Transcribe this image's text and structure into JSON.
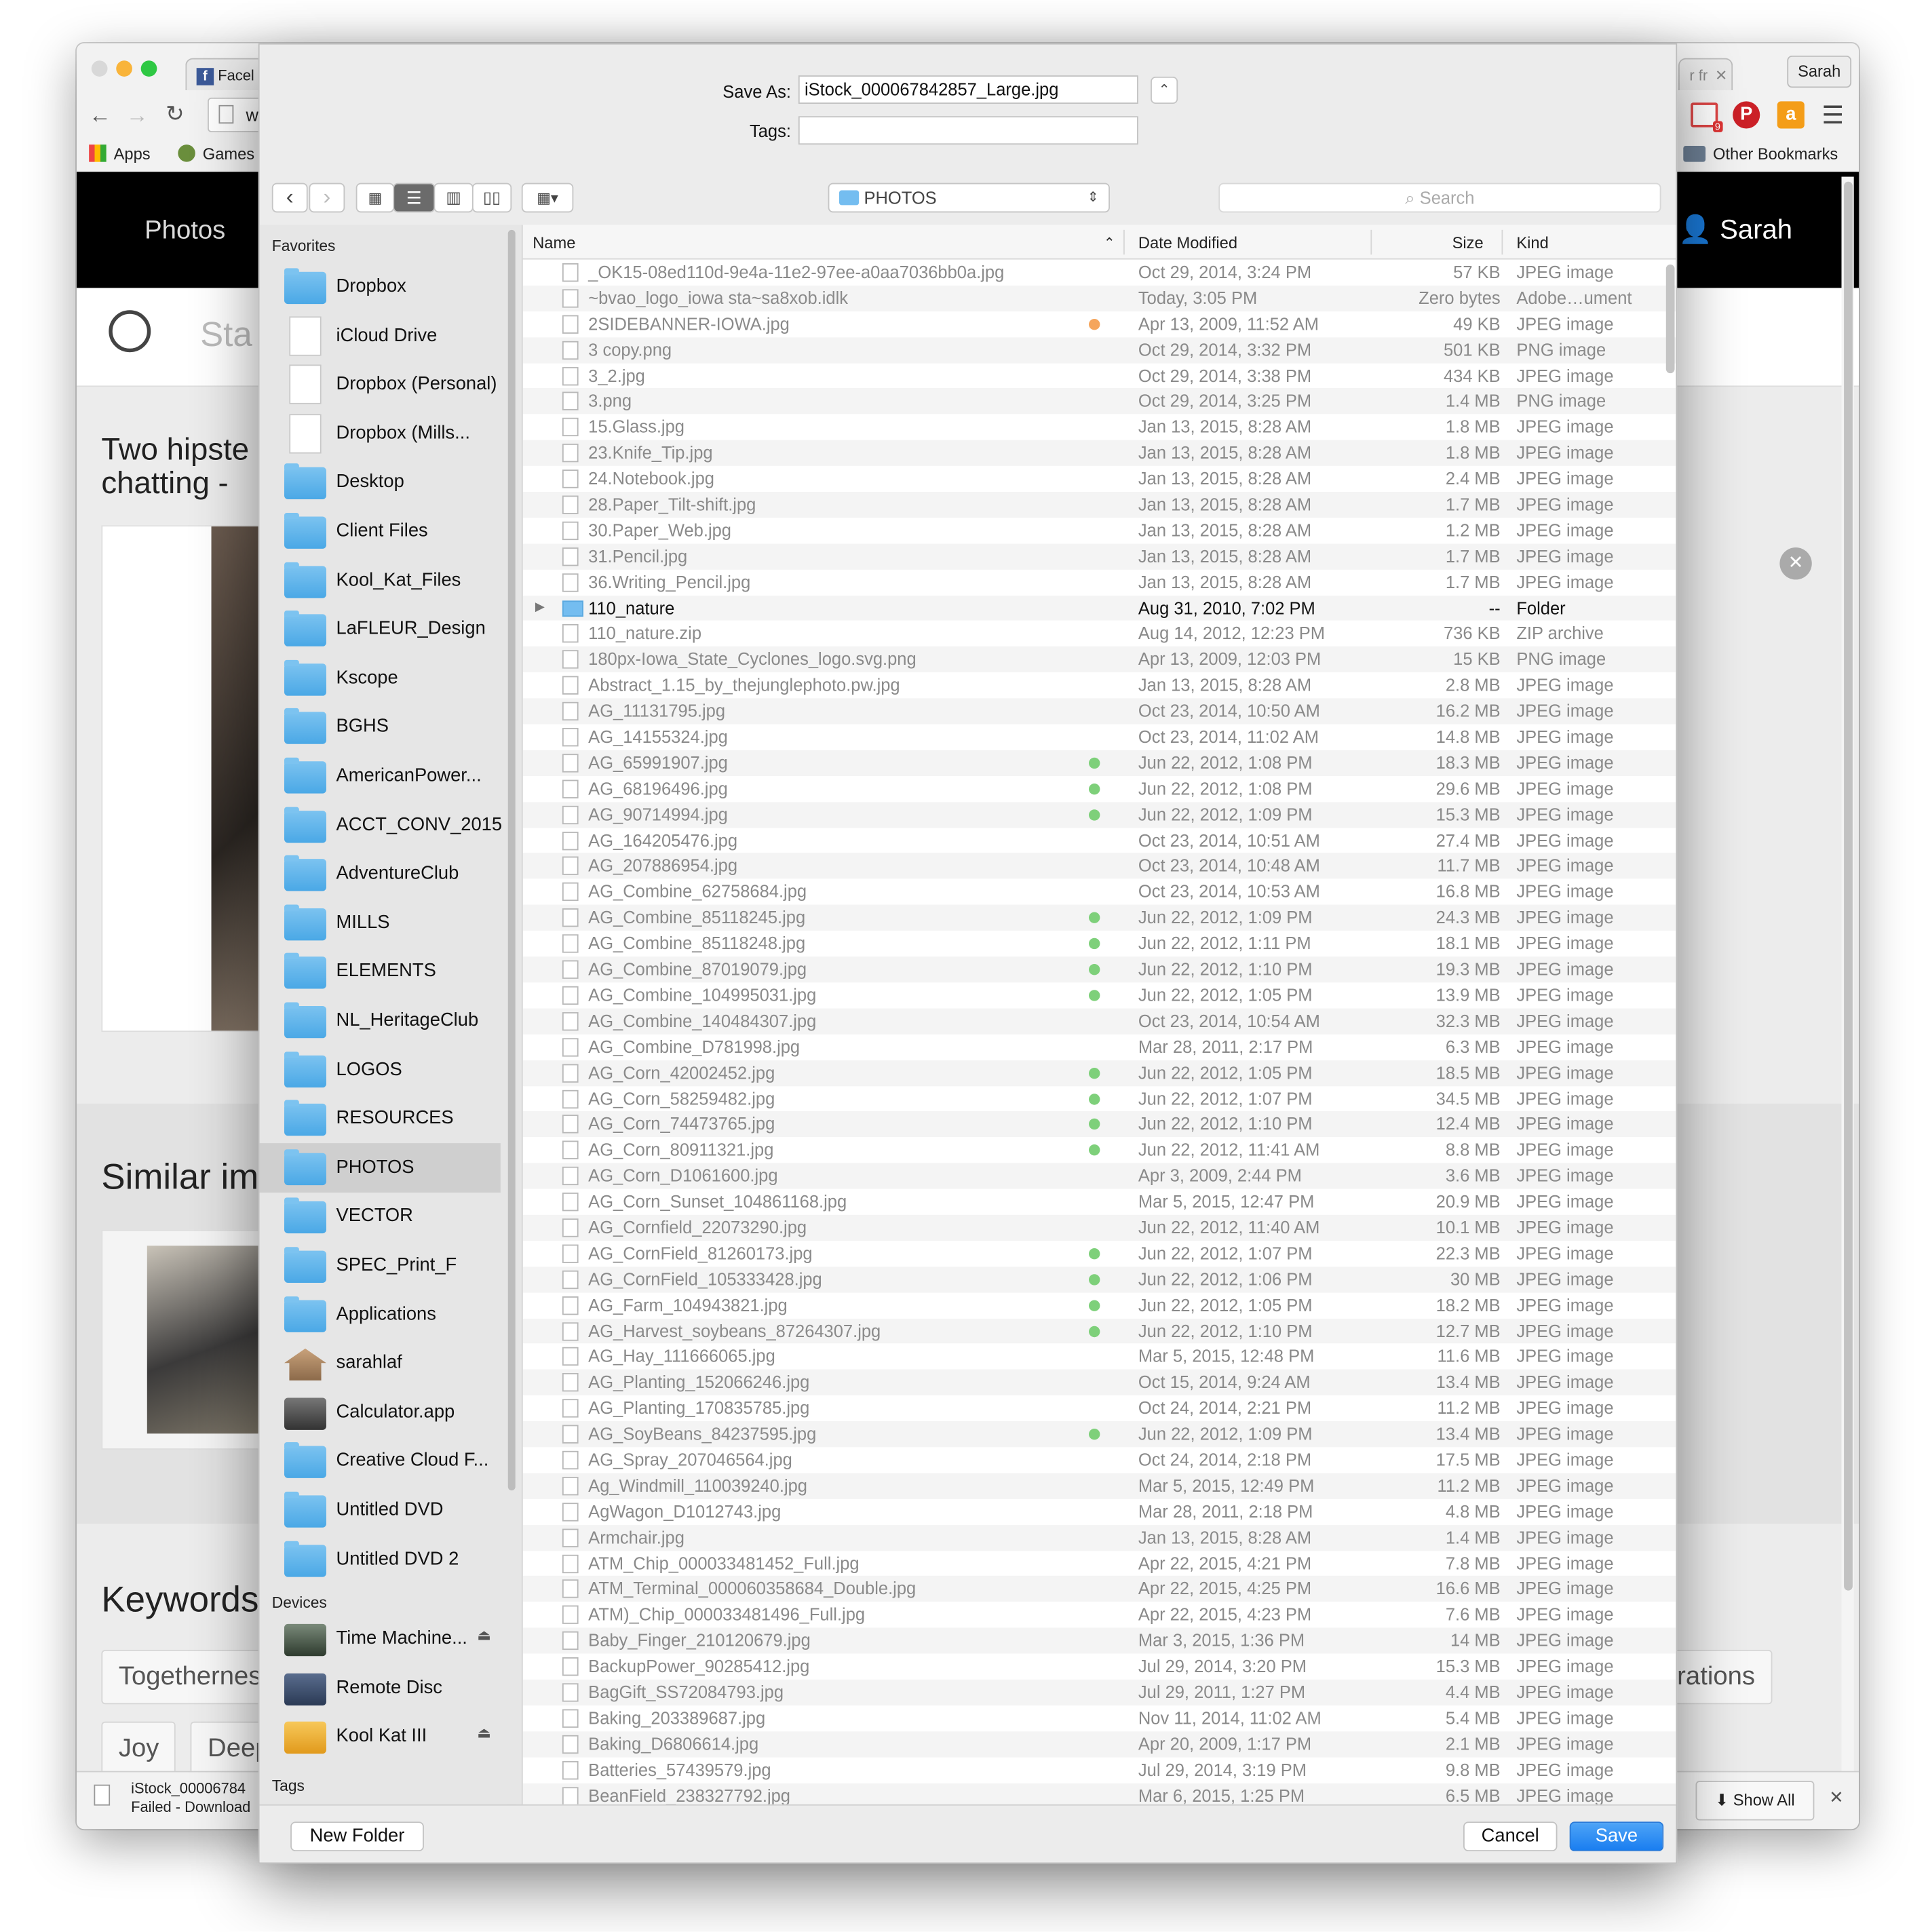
{
  "browser": {
    "tabs": [
      {
        "label": "Facel"
      },
      {
        "label": "r fr"
      }
    ],
    "profile": "Sarah",
    "address": "ww",
    "bookmarks": {
      "apps": "Apps",
      "games": "Games",
      "other": "Other Bookmarks"
    },
    "icon_badge": "9",
    "site": {
      "nav_photos": "Photos",
      "user": "Sarah",
      "search_placeholder": "Sta",
      "title_line1": "Two hipste",
      "title_line2": "chatting -",
      "similar": "Similar im",
      "keywords": "Keywords",
      "kw1": "Togethernes",
      "kw2": "rations",
      "kw3": "Joy",
      "kw4": "Deep"
    },
    "download": {
      "filename": "iStock_00006784",
      "status": "Failed - Download",
      "show_all": "Show All"
    }
  },
  "dialog": {
    "save_as_label": "Save As:",
    "save_as_value": "iStock_000067842857_Large.jpg",
    "tags_label": "Tags:",
    "tags_value": "",
    "location": "PHOTOS",
    "search_placeholder": "Search",
    "favorites_header": "Favorites",
    "devices_header": "Devices",
    "tags_header": "Tags",
    "favorites": [
      {
        "label": "Dropbox",
        "icon": "dropbox-folder-icon"
      },
      {
        "label": "iCloud Drive",
        "icon": "document-icon"
      },
      {
        "label": "Dropbox (Personal)",
        "icon": "document-icon"
      },
      {
        "label": "Dropbox (Mills...",
        "icon": "document-icon"
      },
      {
        "label": "Desktop",
        "icon": "desktop-folder-icon"
      },
      {
        "label": "Client Files",
        "icon": "folder-icon"
      },
      {
        "label": "Kool_Kat_Files",
        "icon": "folder-icon"
      },
      {
        "label": "LaFLEUR_Design",
        "icon": "folder-icon"
      },
      {
        "label": "Kscope",
        "icon": "folder-icon"
      },
      {
        "label": "BGHS",
        "icon": "folder-icon"
      },
      {
        "label": "AmericanPower...",
        "icon": "folder-icon"
      },
      {
        "label": "ACCT_CONV_2015",
        "icon": "folder-icon"
      },
      {
        "label": "AdventureClub",
        "icon": "folder-icon"
      },
      {
        "label": "MILLS",
        "icon": "folder-icon"
      },
      {
        "label": "ELEMENTS",
        "icon": "folder-icon"
      },
      {
        "label": "NL_HeritageClub",
        "icon": "folder-icon"
      },
      {
        "label": "LOGOS",
        "icon": "folder-icon"
      },
      {
        "label": "RESOURCES",
        "icon": "folder-icon"
      },
      {
        "label": "PHOTOS",
        "icon": "folder-icon"
      },
      {
        "label": "VECTOR",
        "icon": "folder-icon"
      },
      {
        "label": "SPEC_Print_F",
        "icon": "folder-icon"
      },
      {
        "label": "Applications",
        "icon": "applications-folder-icon"
      },
      {
        "label": "sarahlaf",
        "icon": "home-icon"
      },
      {
        "label": "Calculator.app",
        "icon": "calculator-icon"
      },
      {
        "label": "Creative Cloud F...",
        "icon": "creative-cloud-folder-icon"
      },
      {
        "label": "Untitled DVD",
        "icon": "dvd-icon"
      },
      {
        "label": "Untitled DVD 2",
        "icon": "dvd-icon"
      }
    ],
    "devices": [
      {
        "label": "Time Machine...",
        "icon": "time-machine-icon"
      },
      {
        "label": "Remote Disc",
        "icon": "remote-disc-icon"
      },
      {
        "label": "Kool Kat III",
        "icon": "external-drive-icon"
      }
    ],
    "columns": {
      "name": "Name",
      "date": "Date Modified",
      "size": "Size",
      "kind": "Kind"
    },
    "files": [
      {
        "name": "_OK15-08ed110d-9e4a-11e2-97ee-a0aa7036bb0a.jpg",
        "date": "Oct 29, 2014, 3:24 PM",
        "size": "57 KB",
        "kind": "JPEG image"
      },
      {
        "name": "~bvao_logo_iowa sta~sa8xob.idlk",
        "date": "Today, 3:05 PM",
        "size": "Zero bytes",
        "kind": "Adobe…ument"
      },
      {
        "name": "2SIDEBANNER-IOWA.jpg",
        "date": "Apr 13, 2009, 11:52 AM",
        "size": "49 KB",
        "kind": "JPEG image",
        "tag": "#f5a55c"
      },
      {
        "name": "3 copy.png",
        "date": "Oct 29, 2014, 3:32 PM",
        "size": "501 KB",
        "kind": "PNG image"
      },
      {
        "name": "3_2.jpg",
        "date": "Oct 29, 2014, 3:38 PM",
        "size": "434 KB",
        "kind": "JPEG image"
      },
      {
        "name": "3.png",
        "date": "Oct 29, 2014, 3:25 PM",
        "size": "1.4 MB",
        "kind": "PNG image"
      },
      {
        "name": "15.Glass.jpg",
        "date": "Jan 13, 2015, 8:28 AM",
        "size": "1.8 MB",
        "kind": "JPEG image"
      },
      {
        "name": "23.Knife_Tip.jpg",
        "date": "Jan 13, 2015, 8:28 AM",
        "size": "1.8 MB",
        "kind": "JPEG image"
      },
      {
        "name": "24.Notebook.jpg",
        "date": "Jan 13, 2015, 8:28 AM",
        "size": "2.4 MB",
        "kind": "JPEG image"
      },
      {
        "name": "28.Paper_Tilt-shift.jpg",
        "date": "Jan 13, 2015, 8:28 AM",
        "size": "1.7 MB",
        "kind": "JPEG image"
      },
      {
        "name": "30.Paper_Web.jpg",
        "date": "Jan 13, 2015, 8:28 AM",
        "size": "1.2 MB",
        "kind": "JPEG image"
      },
      {
        "name": "31.Pencil.jpg",
        "date": "Jan 13, 2015, 8:28 AM",
        "size": "1.7 MB",
        "kind": "JPEG image"
      },
      {
        "name": "36.Writing_Pencil.jpg",
        "date": "Jan 13, 2015, 8:28 AM",
        "size": "1.7 MB",
        "kind": "JPEG image"
      },
      {
        "name": "110_nature",
        "date": "Aug 31, 2010, 7:02 PM",
        "size": "--",
        "kind": "Folder",
        "folder": true
      },
      {
        "name": "110_nature.zip",
        "date": "Aug 14, 2012, 12:23 PM",
        "size": "736 KB",
        "kind": "ZIP archive"
      },
      {
        "name": "180px-Iowa_State_Cyclones_logo.svg.png",
        "date": "Apr 13, 2009, 12:03 PM",
        "size": "15 KB",
        "kind": "PNG image"
      },
      {
        "name": "Abstract_1.15_by_thejunglephoto.pw.jpg",
        "date": "Jan 13, 2015, 8:28 AM",
        "size": "2.8 MB",
        "kind": "JPEG image"
      },
      {
        "name": "AG_11131795.jpg",
        "date": "Oct 23, 2014, 10:50 AM",
        "size": "16.2 MB",
        "kind": "JPEG image"
      },
      {
        "name": "AG_14155324.jpg",
        "date": "Oct 23, 2014, 11:02 AM",
        "size": "14.8 MB",
        "kind": "JPEG image"
      },
      {
        "name": "AG_65991907.jpg",
        "date": "Jun 22, 2012, 1:08 PM",
        "size": "18.3 MB",
        "kind": "JPEG image",
        "tag": "#7ed07a"
      },
      {
        "name": "AG_68196496.jpg",
        "date": "Jun 22, 2012, 1:08 PM",
        "size": "29.6 MB",
        "kind": "JPEG image",
        "tag": "#7ed07a"
      },
      {
        "name": "AG_90714994.jpg",
        "date": "Jun 22, 2012, 1:09 PM",
        "size": "15.3 MB",
        "kind": "JPEG image",
        "tag": "#7ed07a"
      },
      {
        "name": "AG_164205476.jpg",
        "date": "Oct 23, 2014, 10:51 AM",
        "size": "27.4 MB",
        "kind": "JPEG image"
      },
      {
        "name": "AG_207886954.jpg",
        "date": "Oct 23, 2014, 10:48 AM",
        "size": "11.7 MB",
        "kind": "JPEG image"
      },
      {
        "name": "AG_Combine_62758684.jpg",
        "date": "Oct 23, 2014, 10:53 AM",
        "size": "16.8 MB",
        "kind": "JPEG image"
      },
      {
        "name": "AG_Combine_85118245.jpg",
        "date": "Jun 22, 2012, 1:09 PM",
        "size": "24.3 MB",
        "kind": "JPEG image",
        "tag": "#7ed07a"
      },
      {
        "name": "AG_Combine_85118248.jpg",
        "date": "Jun 22, 2012, 1:11 PM",
        "size": "18.1 MB",
        "kind": "JPEG image",
        "tag": "#7ed07a"
      },
      {
        "name": "AG_Combine_87019079.jpg",
        "date": "Jun 22, 2012, 1:10 PM",
        "size": "19.3 MB",
        "kind": "JPEG image",
        "tag": "#7ed07a"
      },
      {
        "name": "AG_Combine_104995031.jpg",
        "date": "Jun 22, 2012, 1:05 PM",
        "size": "13.9 MB",
        "kind": "JPEG image",
        "tag": "#7ed07a"
      },
      {
        "name": "AG_Combine_140484307.jpg",
        "date": "Oct 23, 2014, 10:54 AM",
        "size": "32.3 MB",
        "kind": "JPEG image"
      },
      {
        "name": "AG_Combine_D781998.jpg",
        "date": "Mar 28, 2011, 2:17 PM",
        "size": "6.3 MB",
        "kind": "JPEG image"
      },
      {
        "name": "AG_Corn_42002452.jpg",
        "date": "Jun 22, 2012, 1:05 PM",
        "size": "18.5 MB",
        "kind": "JPEG image",
        "tag": "#7ed07a"
      },
      {
        "name": "AG_Corn_58259482.jpg",
        "date": "Jun 22, 2012, 1:07 PM",
        "size": "34.5 MB",
        "kind": "JPEG image",
        "tag": "#7ed07a"
      },
      {
        "name": "AG_Corn_74473765.jpg",
        "date": "Jun 22, 2012, 1:10 PM",
        "size": "12.4 MB",
        "kind": "JPEG image",
        "tag": "#7ed07a"
      },
      {
        "name": "AG_Corn_80911321.jpg",
        "date": "Jun 22, 2012, 11:41 AM",
        "size": "8.8 MB",
        "kind": "JPEG image",
        "tag": "#7ed07a"
      },
      {
        "name": "AG_Corn_D1061600.jpg",
        "date": "Apr 3, 2009, 2:44 PM",
        "size": "3.6 MB",
        "kind": "JPEG image"
      },
      {
        "name": "AG_Corn_Sunset_104861168.jpg",
        "date": "Mar 5, 2015, 12:47 PM",
        "size": "20.9 MB",
        "kind": "JPEG image"
      },
      {
        "name": "AG_Cornfield_22073290.jpg",
        "date": "Jun 22, 2012, 11:40 AM",
        "size": "10.1 MB",
        "kind": "JPEG image"
      },
      {
        "name": "AG_CornField_81260173.jpg",
        "date": "Jun 22, 2012, 1:07 PM",
        "size": "22.3 MB",
        "kind": "JPEG image",
        "tag": "#7ed07a"
      },
      {
        "name": "AG_CornField_105333428.jpg",
        "date": "Jun 22, 2012, 1:06 PM",
        "size": "30 MB",
        "kind": "JPEG image",
        "tag": "#7ed07a"
      },
      {
        "name": "AG_Farm_104943821.jpg",
        "date": "Jun 22, 2012, 1:05 PM",
        "size": "18.2 MB",
        "kind": "JPEG image",
        "tag": "#7ed07a"
      },
      {
        "name": "AG_Harvest_soybeans_87264307.jpg",
        "date": "Jun 22, 2012, 1:10 PM",
        "size": "12.7 MB",
        "kind": "JPEG image",
        "tag": "#7ed07a"
      },
      {
        "name": "AG_Hay_111666065.jpg",
        "date": "Mar 5, 2015, 12:48 PM",
        "size": "11.6 MB",
        "kind": "JPEG image"
      },
      {
        "name": "AG_Planting_152066246.jpg",
        "date": "Oct 15, 2014, 9:24 AM",
        "size": "13.4 MB",
        "kind": "JPEG image"
      },
      {
        "name": "AG_Planting_170835785.jpg",
        "date": "Oct 24, 2014, 2:21 PM",
        "size": "11.2 MB",
        "kind": "JPEG image"
      },
      {
        "name": "AG_SoyBeans_84237595.jpg",
        "date": "Jun 22, 2012, 1:09 PM",
        "size": "13.4 MB",
        "kind": "JPEG image",
        "tag": "#7ed07a"
      },
      {
        "name": "AG_Spray_207046564.jpg",
        "date": "Oct 24, 2014, 2:18 PM",
        "size": "17.5 MB",
        "kind": "JPEG image"
      },
      {
        "name": "Ag_Windmill_110039240.jpg",
        "date": "Mar 5, 2015, 12:49 PM",
        "size": "11.2 MB",
        "kind": "JPEG image"
      },
      {
        "name": "AgWagon_D1012743.jpg",
        "date": "Mar 28, 2011, 2:18 PM",
        "size": "4.8 MB",
        "kind": "JPEG image"
      },
      {
        "name": "Armchair.jpg",
        "date": "Jan 13, 2015, 8:28 AM",
        "size": "1.4 MB",
        "kind": "JPEG image"
      },
      {
        "name": "ATM_Chip_000033481452_Full.jpg",
        "date": "Apr 22, 2015, 4:21 PM",
        "size": "7.8 MB",
        "kind": "JPEG image"
      },
      {
        "name": "ATM_Terminal_000060358684_Double.jpg",
        "date": "Apr 22, 2015, 4:25 PM",
        "size": "16.6 MB",
        "kind": "JPEG image"
      },
      {
        "name": "ATM)_Chip_000033481496_Full.jpg",
        "date": "Apr 22, 2015, 4:23 PM",
        "size": "7.6 MB",
        "kind": "JPEG image"
      },
      {
        "name": "Baby_Finger_210120679.jpg",
        "date": "Mar 3, 2015, 1:36 PM",
        "size": "14 MB",
        "kind": "JPEG image"
      },
      {
        "name": "BackupPower_90285412.jpg",
        "date": "Jul 29, 2014, 3:20 PM",
        "size": "15.3 MB",
        "kind": "JPEG image"
      },
      {
        "name": "BagGift_SS72084793.jpg",
        "date": "Jul 29, 2011, 1:27 PM",
        "size": "4.4 MB",
        "kind": "JPEG image"
      },
      {
        "name": "Baking_203389687.jpg",
        "date": "Nov 11, 2014, 11:02 AM",
        "size": "5.4 MB",
        "kind": "JPEG image"
      },
      {
        "name": "Baking_D6806614.jpg",
        "date": "Apr 20, 2009, 1:17 PM",
        "size": "2.1 MB",
        "kind": "JPEG image"
      },
      {
        "name": "Batteries_57439579.jpg",
        "date": "Jul 29, 2014, 3:19 PM",
        "size": "9.8 MB",
        "kind": "JPEG image"
      },
      {
        "name": "BeanField_238327792.jpg",
        "date": "Mar 6, 2015, 1:25 PM",
        "size": "6.5 MB",
        "kind": "JPEG image"
      }
    ],
    "new_folder": "New Folder",
    "cancel": "Cancel",
    "save": "Save"
  }
}
